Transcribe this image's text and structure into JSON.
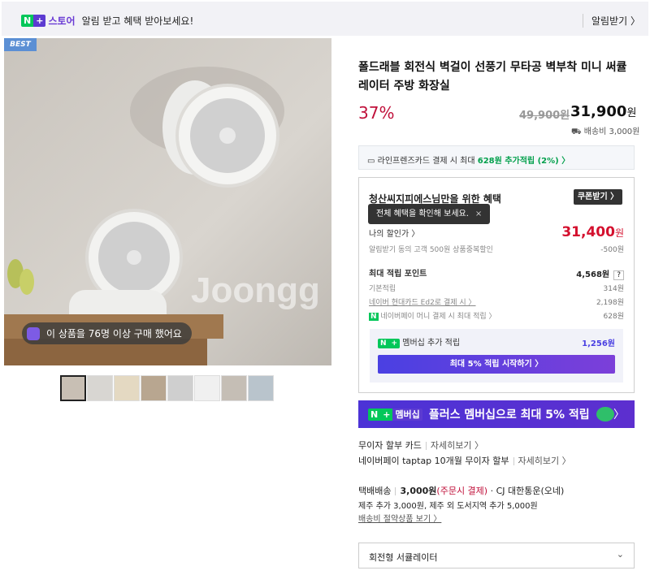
{
  "top_bar": {
    "badge_n": "N",
    "badge_plus": "+",
    "store_name": "스토어",
    "message": "알림 받고 혜택 받아보세요!",
    "subscribe_link": "알림받기 〉"
  },
  "gallery": {
    "best_tag": "BEST",
    "buy_notice": "이 상품을 76명 이상 구매 했어요",
    "thumbnail_count": 8,
    "selected_thumbnail": 1
  },
  "product": {
    "title": "폴드래블 회전식 벽걸이 선풍기 무타공 벽부착 미니 써큘레이터 주방 화장실",
    "discount": "37%",
    "original_price": "49,900원",
    "sale_price": "31,900",
    "price_unit": "원",
    "shipping_fee": "배송비 3,000원"
  },
  "card_promo": {
    "text_prefix": "라인프렌즈카드 결제 시 최대 ",
    "amount": "628원",
    "text_suffix": " 추가적립 (2%) 〉"
  },
  "benefits": {
    "title": "청산씨지피에스님만을 위한 혜택",
    "coupon_button": "쿠폰받기 〉",
    "tooltip": "전체 혜택을 확인해 보세요.",
    "tooltip_close": "×",
    "my_price_label": "나의 할인가 〉",
    "my_price_value": "31,400",
    "my_price_unit": "원",
    "alert_discount_label": "알림받기 동의 고객 500원 상품중복할인",
    "alert_discount_value": "-500원",
    "max_points_label": "최대 적립 포인트",
    "max_points_value": "4,568원",
    "help_icon": "?",
    "point_rows": [
      {
        "label": "기본적립",
        "value": "314원"
      },
      {
        "label": "네이버 현대카드 Ed2로 결제 시 〉",
        "value": "2,198원"
      },
      {
        "label": "네이버페이 머니 결제 시 최대 적립 〉",
        "value": "628원"
      }
    ],
    "membership_badge": "멤버십",
    "membership_label": "멤버십 추가 적립",
    "membership_value": "1,256원",
    "membership_button": "최대 5% 적립 시작하기 〉"
  },
  "plus_banner": {
    "badge": "멤버십",
    "text": "플러스 멤버십으로 최대 5% 적립",
    "chevron": "〉"
  },
  "installments": {
    "card_label": "무이자 할부 카드",
    "card_link": "자세히보기 〉",
    "pay_label": "네이버페이 taptap 10개월 무이자 할부",
    "pay_link": "자세히보기 〉"
  },
  "delivery": {
    "method": "택배배송",
    "fee": "3,000원",
    "fee_note": "(주문시 결제)",
    "carrier": "· CJ 대한통운(오네)",
    "jeju_note": "제주 추가 3,000원, 제주 외 도서지역 추가 5,000원",
    "saving_link": "배송비 절약상품 보기 〉"
  },
  "option": {
    "placeholder": "회전형 서큘레이터",
    "arrow": "⌄"
  }
}
